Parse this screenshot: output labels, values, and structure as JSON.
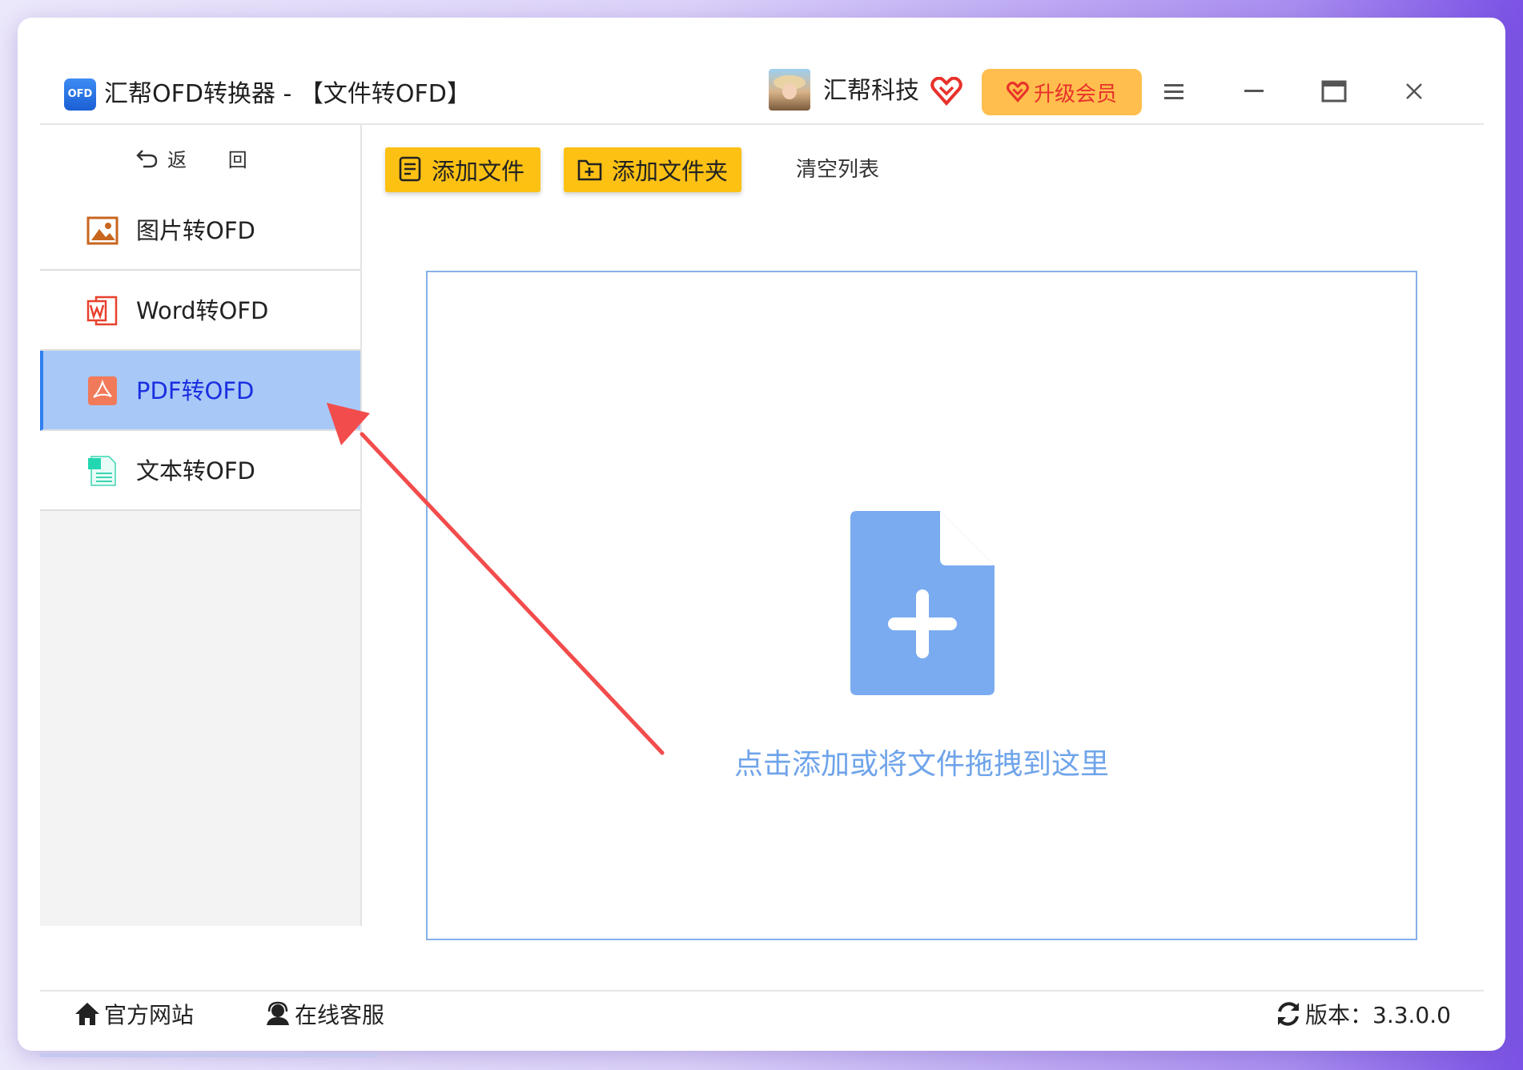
{
  "app": {
    "icon_text": "OFD",
    "title": "汇帮OFD转换器 - 【文件转OFD】"
  },
  "user": {
    "name": "汇帮科技",
    "upgrade_label": "升级会员"
  },
  "sidebar": {
    "back_label": "返 回",
    "items": [
      {
        "label": "图片转OFD",
        "icon": "image-icon",
        "active": false
      },
      {
        "label": "Word转OFD",
        "icon": "word-icon",
        "active": false
      },
      {
        "label": "PDF转OFD",
        "icon": "pdf-icon",
        "active": true
      },
      {
        "label": "文本转OFD",
        "icon": "text-file-icon",
        "active": false
      }
    ]
  },
  "toolbar": {
    "add_file_label": "添加文件",
    "add_folder_label": "添加文件夹",
    "clear_label": "清空列表"
  },
  "dropzone": {
    "hint": "点击添加或将文件拖拽到这里"
  },
  "footer": {
    "website_label": "官方网站",
    "support_label": "在线客服",
    "version_label": "版本：3.3.0.0"
  },
  "colors": {
    "accent": "#2f7ff0",
    "active_bg": "#a8c8f8",
    "button_yellow": "#fdc114",
    "upgrade_orange": "#ffbe4d",
    "annotation_arrow": "#f24c4c",
    "drop_icon": "#7aabf0"
  }
}
